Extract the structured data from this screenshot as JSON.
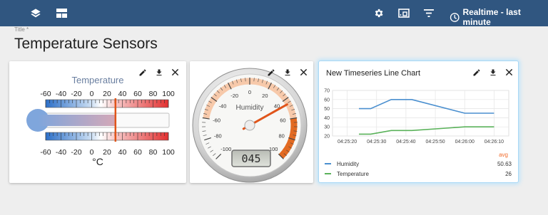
{
  "toolbar": {
    "icons": [
      "layers-icon",
      "dashboard-icon",
      "settings-icon",
      "fullscreen-icon",
      "filter-icon",
      "clock-icon"
    ],
    "realtime_label": "Realtime - last minute"
  },
  "dashboard": {
    "title_hint": "Title *",
    "title": "Temperature Sensors"
  },
  "widgets": {
    "thermometer": {
      "title": "Temperature",
      "scale": [
        "-60",
        "-40",
        "-20",
        "0",
        "20",
        "40",
        "60",
        "80",
        "100"
      ],
      "unit": "°C",
      "value": 31,
      "min": -60,
      "max": 100
    },
    "gauge": {
      "title": "Humidity",
      "scale": [
        "-100",
        "-80",
        "-60",
        "-40",
        "-20",
        "0",
        "20",
        "40",
        "60",
        "80",
        "100"
      ],
      "display": "045",
      "value": 45,
      "min": -100,
      "max": 100
    },
    "timeseries": {
      "title": "New Timeseries Line Chart",
      "avg_label": "avg",
      "legend": [
        {
          "name": "Humidity",
          "value": "50.63",
          "color": "#4a8fcf"
        },
        {
          "name": "Temperature",
          "value": "26",
          "color": "#5ab25a"
        }
      ]
    },
    "actions": {
      "edit": "edit-icon",
      "download": "download-icon",
      "close": "close-icon"
    }
  },
  "chart_data": {
    "type": "line",
    "title": "New Timeseries Line Chart",
    "x_ticks": [
      "04:25:20",
      "04:25:30",
      "04:25:40",
      "04:25:50",
      "04:26:00",
      "04:26:10"
    ],
    "y_ticks": [
      "20",
      "30",
      "40",
      "50",
      "60",
      "70"
    ],
    "ylim": [
      20,
      70
    ],
    "xlim": [
      "04:25:15",
      "04:26:15"
    ],
    "grid": true,
    "legend_position": "bottom",
    "series": [
      {
        "name": "Humidity",
        "color": "#4a8fcf",
        "x": [
          "04:25:24",
          "04:25:28",
          "04:25:35",
          "04:25:42",
          "04:26:00",
          "04:26:10"
        ],
        "y": [
          50,
          50,
          60,
          60,
          45,
          45
        ]
      },
      {
        "name": "Temperature",
        "color": "#5ab25a",
        "x": [
          "04:25:24",
          "04:25:28",
          "04:25:35",
          "04:25:42",
          "04:26:00",
          "04:26:10"
        ],
        "y": [
          22,
          22,
          26,
          26,
          30,
          30
        ]
      }
    ]
  }
}
